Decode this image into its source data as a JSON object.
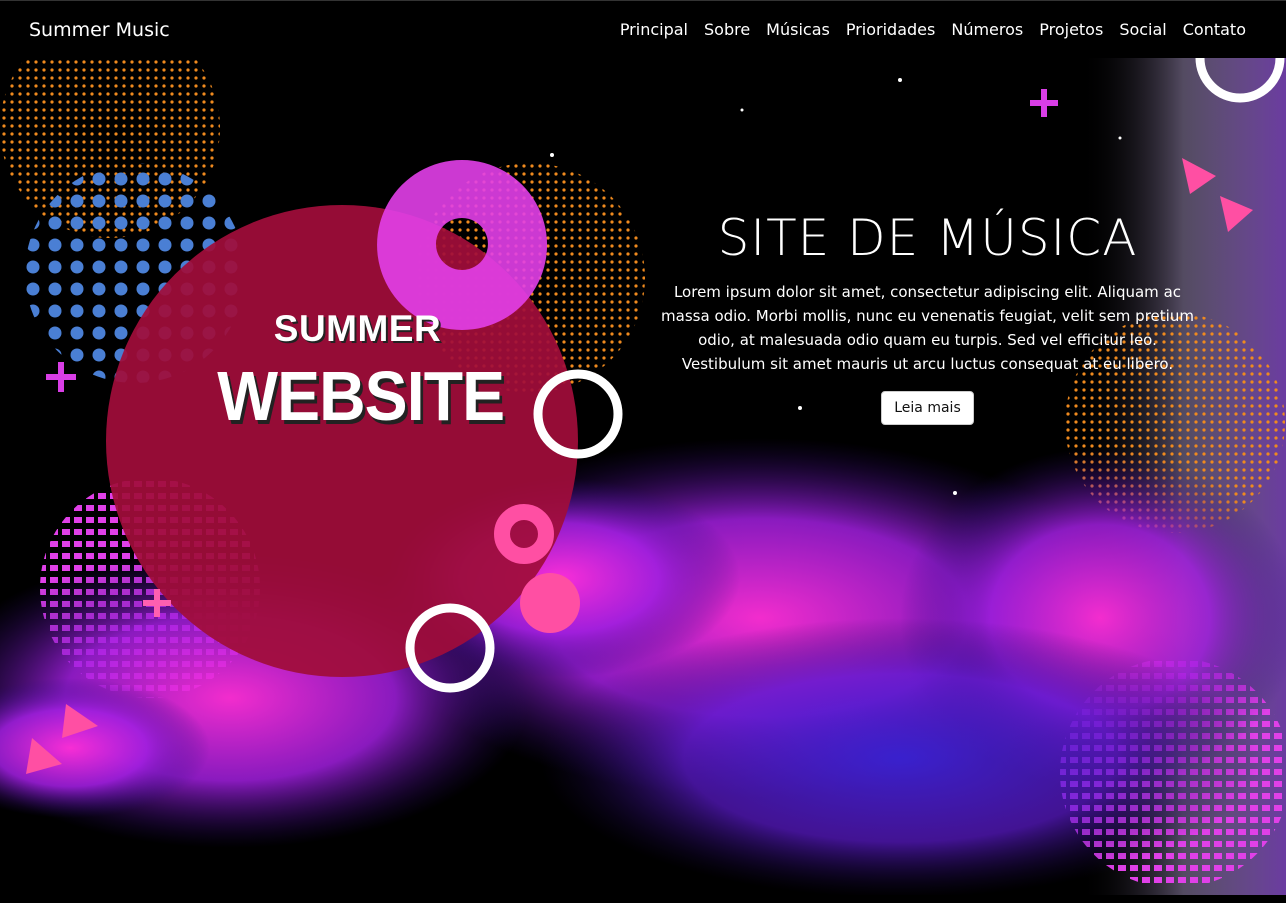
{
  "navbar": {
    "brand": "Summer Music",
    "links": [
      "Principal",
      "Sobre",
      "Músicas",
      "Prioridades",
      "Números",
      "Projetos",
      "Social",
      "Contato"
    ]
  },
  "badge": {
    "line1": "SUMMER",
    "line2": "WEBSITE"
  },
  "hero": {
    "title": "SITE DE MÚSICA",
    "text": "Lorem ipsum dolor sit amet, consectetur adipiscing elit. Aliquam ac massa odio. Morbi mollis, nunc eu venenatis feugiat, velit sem pretium odio, at malesuada odio quam eu turpis. Sed vel efficitur leo. Vestibulum sit amet mauris ut arcu luctus consequat at eu libero.",
    "button": "Leia mais"
  },
  "colors": {
    "background": "#000000",
    "crimson": "#a00d3a",
    "magenta": "#d62bd9",
    "pink": "#ff4fa3",
    "purple": "#8a2be2",
    "orange_dots": "#f08a1e",
    "blue_dots": "#4a7fd4"
  }
}
